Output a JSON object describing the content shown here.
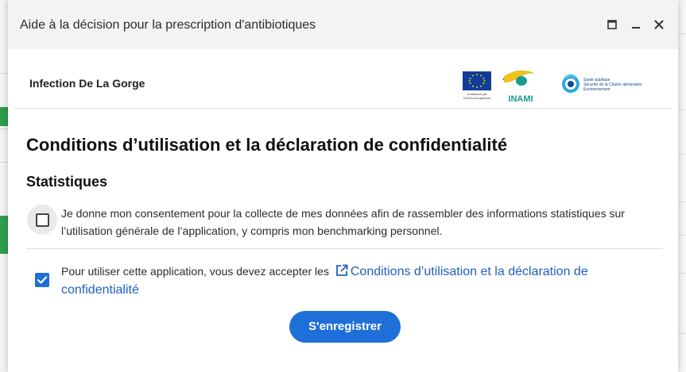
{
  "window": {
    "title": "Aide à la décision pour la prescription d'antibiotiques",
    "maximize_icon": "maximize-icon",
    "minimize_icon": "minimize-icon",
    "close_icon": "close-icon"
  },
  "context": {
    "label": "Infection De La Gorge"
  },
  "logos": {
    "eu_caption": "Cofinancé par l'Union européenne",
    "inami": "INAMI",
    "spf_line1": "Santé publique",
    "spf_line2": "Sécurité de la Chaîne alimentaire",
    "spf_line3": "Environnement"
  },
  "main": {
    "heading": "Conditions d’utilisation et la déclaration de confidentialité",
    "section_title": "Statistiques",
    "consent_stats": {
      "checked": false,
      "text": "Je donne mon consentement pour la collecte de mes données afin de rassembler des informations statistiques sur l’utilisation générale de l’application, y compris mon benchmarking personnel."
    },
    "terms": {
      "checked": true,
      "prefix": "Pour utiliser cette application, vous devez accepter les",
      "link_line1": "Conditions d’utilisation et la déclaration de",
      "link_line2": "confidentialité",
      "link_icon": "external-link-icon"
    },
    "register_button": "S'enregistrer"
  },
  "colors": {
    "primary": "#1f6fd8",
    "link": "#1f5fbf",
    "titlebar_bg": "#f3f3f3",
    "side_green": "#2e9e4a"
  }
}
